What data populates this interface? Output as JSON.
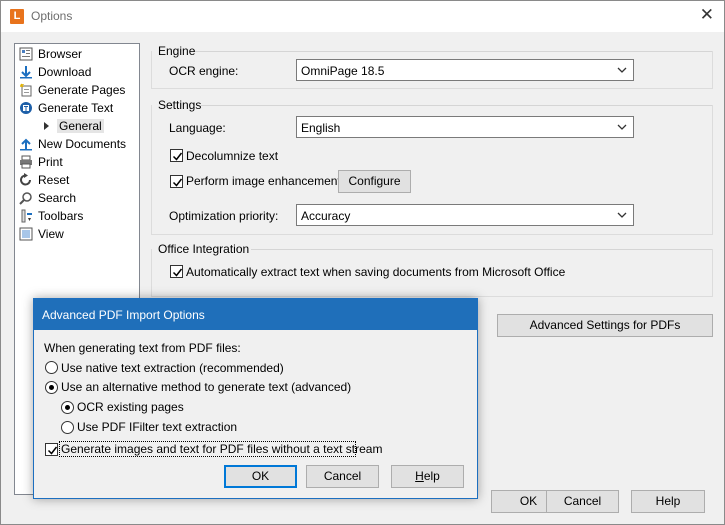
{
  "window": {
    "app_icon_letter": "L",
    "title": "Options",
    "close_glyph": "✕"
  },
  "sidebar": {
    "items": [
      {
        "label": "Browser",
        "icon": "browser-icon"
      },
      {
        "label": "Download",
        "icon": "download-arrow-icon"
      },
      {
        "label": "Generate Pages",
        "icon": "generate-pages-icon"
      },
      {
        "label": "Generate Text",
        "icon": "generate-text-icon"
      },
      {
        "label": "General",
        "icon": "expander-arrow-icon",
        "selected": true
      },
      {
        "label": "New Documents",
        "icon": "upload-arrow-icon"
      },
      {
        "label": "Print",
        "icon": "printer-icon"
      },
      {
        "label": "Reset",
        "icon": "reset-icon"
      },
      {
        "label": "Search",
        "icon": "search-icon"
      },
      {
        "label": "Toolbars",
        "icon": "toolbars-icon"
      },
      {
        "label": "View",
        "icon": "view-icon"
      }
    ]
  },
  "engine": {
    "group_title": "Engine",
    "ocr_label": "OCR engine:",
    "ocr_value": "OmniPage 18.5"
  },
  "settings": {
    "group_title": "Settings",
    "language_label": "Language:",
    "language_value": "English",
    "decolumnize_label": "Decolumnize text",
    "decolumnize_checked": true,
    "enhancement_label": "Perform image enhancement",
    "enhancement_checked": true,
    "configure_button": "Configure",
    "priority_label": "Optimization priority:",
    "priority_value": "Accuracy"
  },
  "office": {
    "group_title": "Office Integration",
    "auto_extract_label": "Automatically extract text when saving documents from Microsoft Office",
    "auto_extract_checked": true
  },
  "advanced_button": "Advanced Settings for PDFs",
  "footer": {
    "ok": "OK",
    "cancel": "Cancel",
    "help": "Help"
  },
  "dialog": {
    "title": "Advanced PDF Import Options",
    "intro": "When generating text from PDF files:",
    "native_option": "Use native text extraction (recommended)",
    "alternative_option": "Use an alternative method to generate text (advanced)",
    "ocr_pages_option": "OCR existing pages",
    "ifilter_option": "Use PDF IFilter text extraction",
    "generate_images_label": "Generate images and text for PDF files without a text stream",
    "generate_images_checked": true,
    "ok": "OK",
    "cancel": "Cancel",
    "help_prefix": "",
    "help_accel": "H",
    "help_rest": "elp"
  },
  "colors": {
    "dialog_titlebar": "#1f6fba",
    "default_button_border": "#0078d7",
    "app_icon": "#e8731c"
  }
}
